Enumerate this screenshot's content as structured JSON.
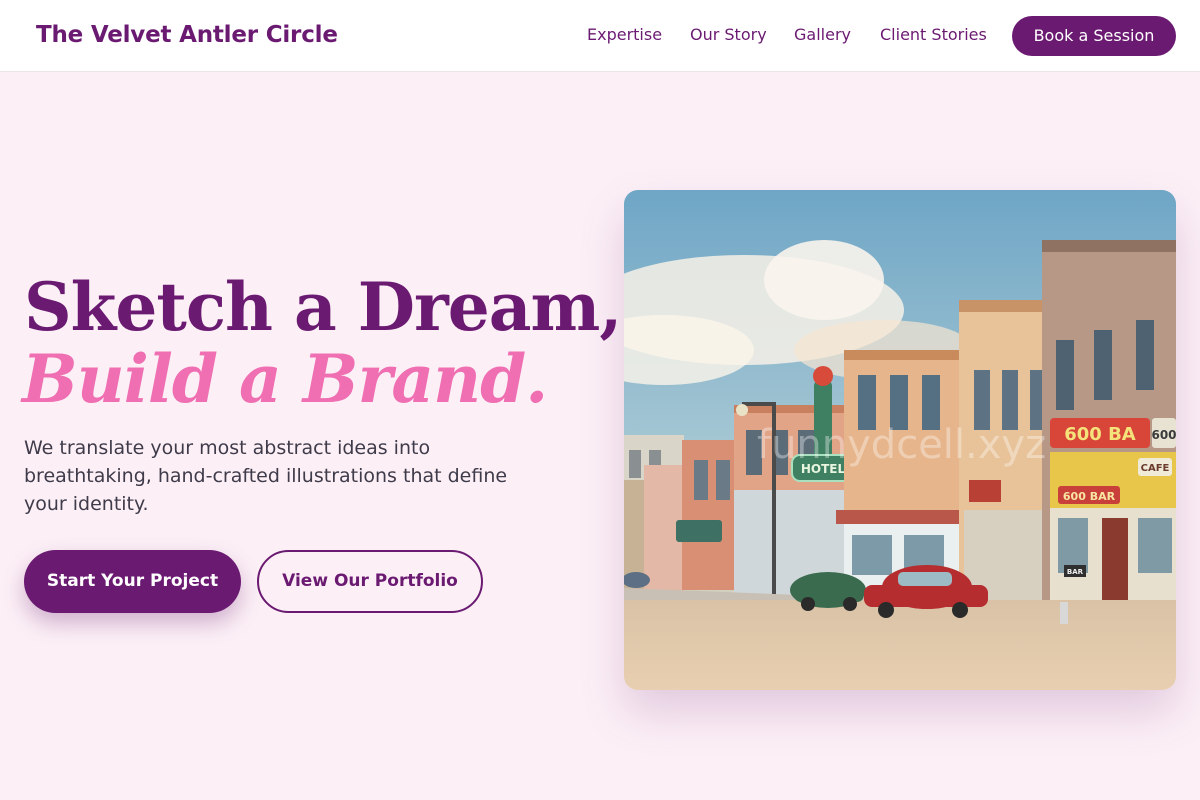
{
  "header": {
    "brand": "The Velvet Antler Circle",
    "nav": [
      "Expertise",
      "Our Story",
      "Gallery",
      "Client Stories"
    ],
    "book_label": "Book a Session"
  },
  "hero": {
    "title_line1": "Sketch a Dream,",
    "title_line2": "Build a Brand.",
    "subtitle": "We translate your most abstract ideas into breathtaking, hand-crafted illustrations that define your identity.",
    "primary_cta": "Start Your Project",
    "secondary_cta": "View Our Portfolio"
  },
  "image": {
    "alt": "Vintage postcard illustration of a main street with hotel signs, storefronts and classic cars",
    "signs": {
      "hotel": "HOTEL",
      "bar_top": "600 BA",
      "bar_lower": "600 BAR",
      "cafe": "CAFE",
      "short_top": "600",
      "bar_small": "BAR"
    },
    "watermark": "funnydcell.xyz"
  },
  "colors": {
    "primary": "#6b1a72",
    "accent": "#ef6fb2",
    "background": "#fcf0f6"
  }
}
